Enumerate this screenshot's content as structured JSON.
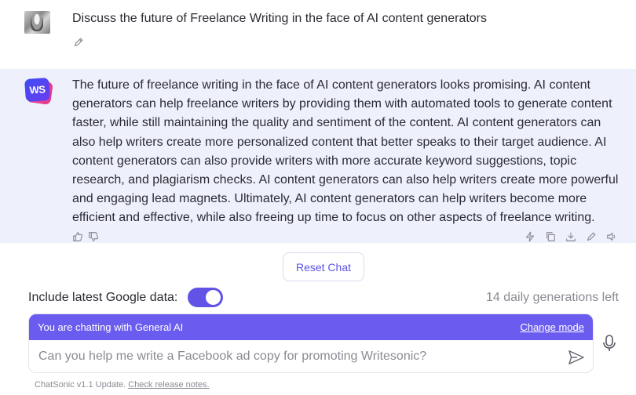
{
  "user_message": {
    "text": "Discuss the future of Freelance Writing in the face of AI content generators"
  },
  "ai_message": {
    "logo_text": "WS",
    "text": "The future of freelance writing in the face of AI content generators looks promising. AI content generators can help freelance writers by providing them with automated tools to generate content faster, while still maintaining the quality and sentiment of the content. AI content generators can also help writers create more personalized content that better speaks to their target audience. AI content generators can also provide writers with more accurate keyword suggestions, topic research, and plagiarism checks. AI content generators can also help writers create more powerful and engaging lead magnets. Ultimately, AI content generators can help writers become more efficient and effective, while also freeing up time to focus on other aspects of freelance writing."
  },
  "reset_label": "Reset Chat",
  "google_data": {
    "label": "Include latest Google data:",
    "enabled": true
  },
  "generations_left": "14 daily generations left",
  "chat": {
    "mode_text": "You are chatting with General AI",
    "change_mode": "Change mode",
    "placeholder": "Can you help me write a Facebook ad copy for promoting Writesonic?"
  },
  "footer": {
    "text": "ChatSonic v1.1 Update.",
    "link": "Check release notes."
  },
  "colors": {
    "accent": "#6b5cf0",
    "ai_bg": "#eef0fb"
  }
}
